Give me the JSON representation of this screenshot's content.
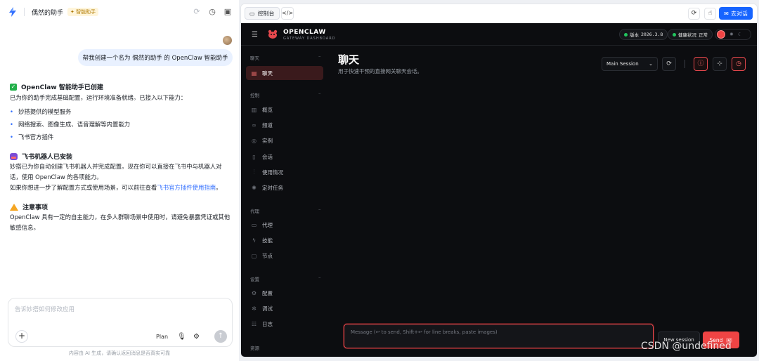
{
  "assistant": {
    "title": "偶然的助手",
    "badge": "智能助手",
    "user_message": "帮我创建一个名为 偶然的助手 的 OpenClaw 智能助手",
    "sections": [
      {
        "heading": "OpenClaw 智能助手已创建",
        "text": "已为你的助手完成基础配置，运行环境准备就绪。已接入以下能力：",
        "items": [
          "妙搭提供的模型服务",
          "网络搜索、图像生成、语音理解等内置能力",
          "飞书官方插件"
        ]
      },
      {
        "heading": "飞书机器人已安装",
        "text_lines": [
          "妙搭已为你自动创建飞书机器人并完成配置。现在你可以直接在飞书中与机器人对",
          "话，使用 OpenClaw 的各项能力。"
        ],
        "text2_prefix": "如果你想进一步了解配置方式或使用场景，可以前往查看",
        "text2_link": "飞书官方插件使用指南",
        "text2_suffix": "。"
      },
      {
        "heading": "注意事项",
        "text_lines": [
          "OpenClaw 具有一定的自主能力，在多人群聊场景中使用时，请避免暴露凭证或其他",
          "敏感信息。"
        ]
      }
    ],
    "input_placeholder": "告诉妙搭如何修改应用",
    "plan_label": "Plan",
    "footer_note": "内容由 AI 生成，请确认返回消息是否真实可靠"
  },
  "preview": {
    "console_tab": "控制台",
    "goto_chat_label": "去对话"
  },
  "dashboard": {
    "brand": "OPENCLAW",
    "brand_sub": "GATEWAY DASHBOARD",
    "version_label": "版本",
    "version_value": "2026.3.8",
    "health_label": "健康状况",
    "health_value": "正常",
    "sidebar": [
      {
        "section": "聊天",
        "items": [
          {
            "label": "聊天",
            "icon": "chat-icon",
            "active": true
          }
        ]
      },
      {
        "section": "控制",
        "items": [
          {
            "label": "概览",
            "icon": "bar-chart-icon"
          },
          {
            "label": "频道",
            "icon": "link-icon"
          },
          {
            "label": "实例",
            "icon": "radio-icon"
          },
          {
            "label": "会话",
            "icon": "file-icon"
          },
          {
            "label": "使用情况",
            "icon": "stats-icon"
          },
          {
            "label": "定时任务",
            "icon": "loader-icon"
          }
        ]
      },
      {
        "section": "代理",
        "items": [
          {
            "label": "代理",
            "icon": "folder-icon"
          },
          {
            "label": "技能",
            "icon": "bolt-icon"
          },
          {
            "label": "节点",
            "icon": "monitor-icon"
          }
        ]
      },
      {
        "section": "设置",
        "items": [
          {
            "label": "配置",
            "icon": "gear-icon"
          },
          {
            "label": "调试",
            "icon": "bug-icon"
          },
          {
            "label": "日志",
            "icon": "log-icon"
          }
        ]
      },
      {
        "section": "资源",
        "items": []
      }
    ],
    "page_title": "聊天",
    "page_subtitle": "用于快速干预的直接网关聊天会话。",
    "session_select": "Main Session",
    "compose_placeholder": "Message (↩ to send, Shift+↩ for line breaks, paste images)",
    "new_session_label": "New session",
    "send_label": "Send",
    "send_kbd": "↵",
    "colors": {
      "accent": "#ef4444",
      "bg": "#0c0d10",
      "ok": "#22c55e"
    }
  },
  "watermark": "CSDN @undefined"
}
